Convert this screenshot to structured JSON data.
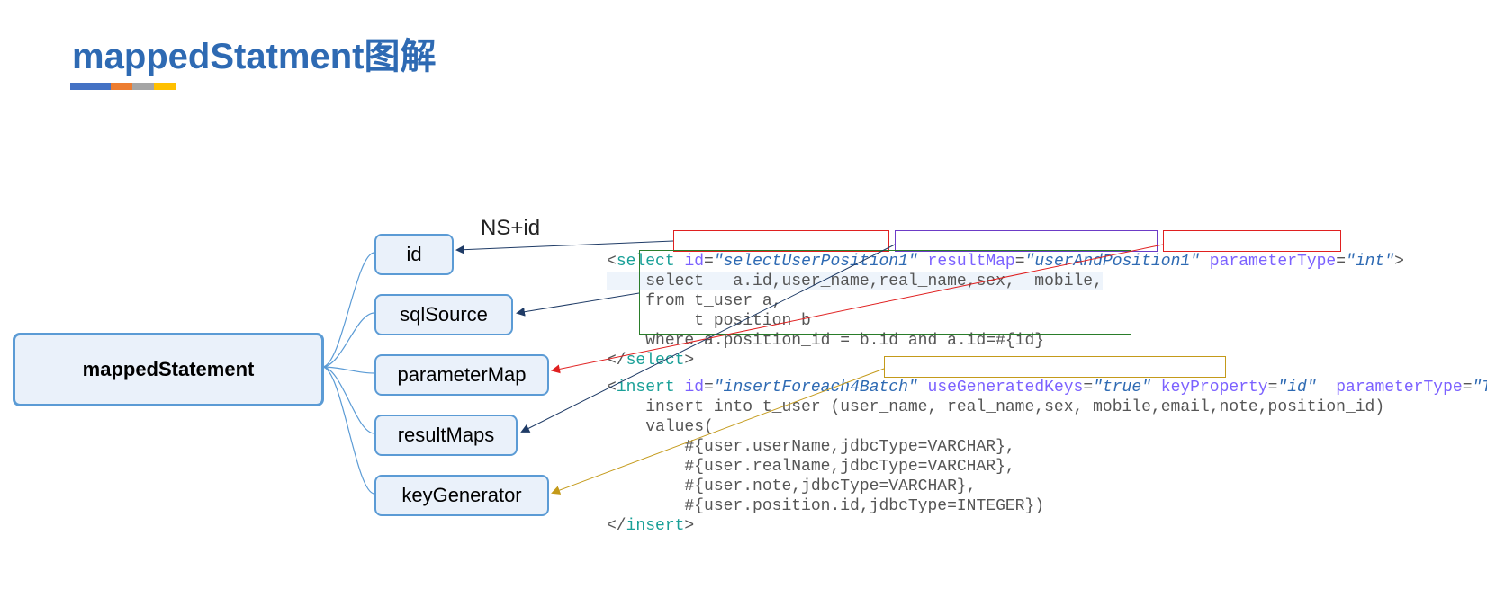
{
  "title": "mappedStatment图解",
  "root": "mappedStatement",
  "branches": [
    "id",
    "sqlSource",
    "parameterMap",
    "resultMaps",
    "keyGenerator"
  ],
  "annot": "NS+id",
  "code": {
    "select": {
      "open_tag": "select",
      "attr_id_name": "id",
      "attr_id_val": "\"selectUserPosition1\"",
      "attr_resMap_name": "resultMap",
      "attr_resMap_val": "\"userAndPosition1\"",
      "attr_pType_name": "parameterType",
      "attr_pType_val": "\"int\"",
      "line1": "select   a.id,user_name,real_name,sex,  mobile,",
      "line2": "from t_user a,",
      "line3": "     t_position b",
      "line4": "where a.position_id = b.id and a.id=#{id}",
      "close_tag": "select"
    },
    "insert": {
      "open_tag": "insert",
      "attr_id_name": "id",
      "attr_id_val": "\"insertForeach4Batch\"",
      "attr_ugk_name": "useGeneratedKeys",
      "attr_ugk_val": "\"true\"",
      "attr_kp_name": "keyProperty",
      "attr_kp_val": "\"id\"",
      "attr_pType_name": "parameterType",
      "attr_pType_val": "\"TUser\"",
      "line1": "insert into t_user (user_name, real_name,sex, mobile,email,note,position_id)",
      "line2": "values(",
      "line3": "    #{user.userName,jdbcType=VARCHAR},",
      "line4": "    #{user.realName,jdbcType=VARCHAR},",
      "line5": "    #{user.note,jdbcType=VARCHAR},",
      "line6": "    #{user.position.id,jdbcType=INTEGER})",
      "close_tag": "insert"
    }
  },
  "colors": {
    "redBox": "#e02020",
    "purpleBox": "#6c3bc7",
    "greenBox": "#2a7d2a",
    "goldBox": "#c49a1a",
    "arrowDark": "#1f3b66",
    "arrowRed": "#e02020",
    "arrowGold": "#c49a1a"
  }
}
